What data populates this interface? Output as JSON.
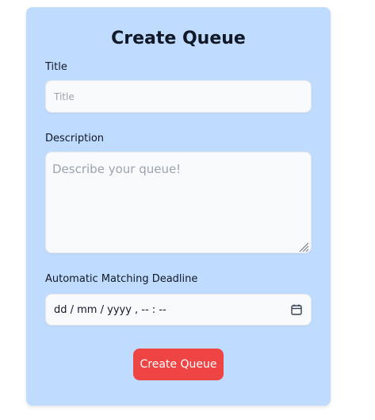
{
  "form": {
    "heading": "Create Queue",
    "title_label": "Title",
    "title_placeholder": "Title",
    "description_label": "Description",
    "description_placeholder": "Describe your queue!",
    "deadline_label": "Automatic Matching Deadline",
    "deadline_display": "dd / mm / yyyy ,  -- : --",
    "submit_label": "Create Queue"
  },
  "colors": {
    "card_background": "#bfdbfe",
    "submit_button": "#ef4444",
    "heading_text": "#111827"
  },
  "icons": {
    "deadline_picker": "calendar-icon"
  }
}
